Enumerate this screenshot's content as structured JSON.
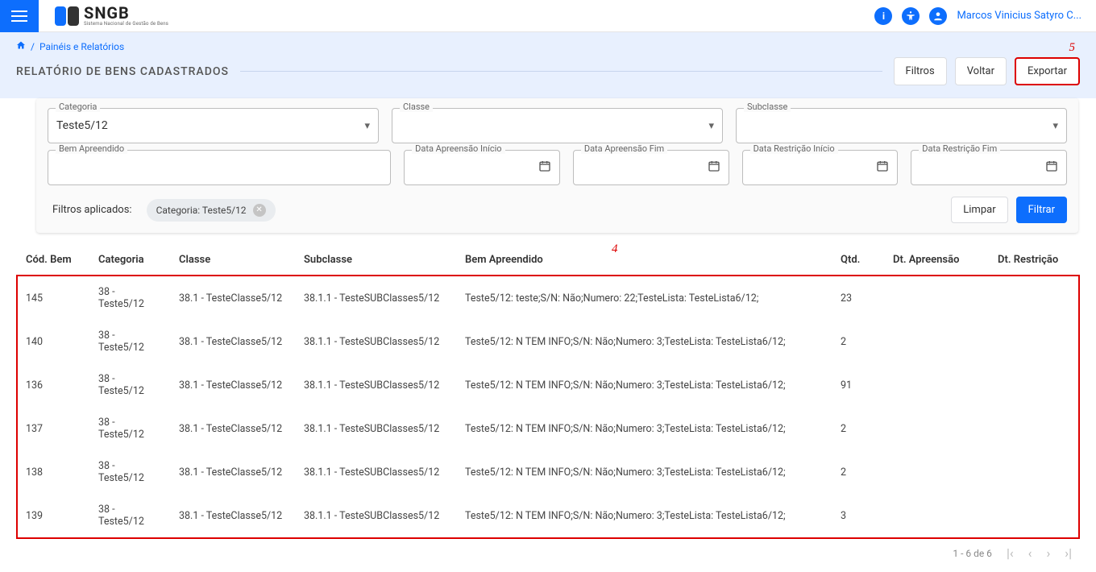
{
  "top": {
    "logo_text": "SNGB",
    "logo_sub": "Sistema Nacional de Gestão de Bens",
    "user": "Marcos Vinicius Satyro C..."
  },
  "breadcrumb": {
    "link": "Painéis e Relatórios"
  },
  "page": {
    "title": "RELATÓRIO DE BENS CADASTRADOS"
  },
  "buttons": {
    "filtros": "Filtros",
    "voltar": "Voltar",
    "exportar": "Exportar",
    "limpar": "Limpar",
    "filtrar": "Filtrar"
  },
  "annotations": {
    "exportar": "5",
    "table": "4"
  },
  "fields": {
    "categoria_label": "Categoria",
    "categoria_value": "Teste5/12",
    "classe_label": "Classe",
    "subclasse_label": "Subclasse",
    "bem_label": "Bem Apreendido",
    "data_ap_inicio": "Data Apreensão Início",
    "data_ap_fim": "Data Apreensão Fim",
    "data_re_inicio": "Data Restrição Início",
    "data_re_fim": "Data Restrição Fim"
  },
  "applied": {
    "label": "Filtros aplicados:",
    "chip": "Categoria: Teste5/12"
  },
  "table": {
    "headers": {
      "cod": "Cód. Bem",
      "cat": "Categoria",
      "cls": "Classe",
      "sub": "Subclasse",
      "bem": "Bem Apreendido",
      "qtd": "Qtd.",
      "dta": "Dt. Apreensão",
      "dtr": "Dt. Restrição"
    },
    "rows": [
      {
        "cod": "145",
        "cat": "38 - Teste5/12",
        "cls": "38.1 - TesteClasse5/12",
        "sub": "38.1.1 - TesteSUBClasses5/12",
        "bem": "Teste5/12: teste;S/N: Não;Numero: 22;TesteLista: TesteLista6/12;",
        "qtd": "23",
        "dta": "",
        "dtr": ""
      },
      {
        "cod": "140",
        "cat": "38 - Teste5/12",
        "cls": "38.1 - TesteClasse5/12",
        "sub": "38.1.1 - TesteSUBClasses5/12",
        "bem": "Teste5/12: N TEM INFO;S/N: Não;Numero: 3;TesteLista: TesteLista6/12;",
        "qtd": "2",
        "dta": "",
        "dtr": ""
      },
      {
        "cod": "136",
        "cat": "38 - Teste5/12",
        "cls": "38.1 - TesteClasse5/12",
        "sub": "38.1.1 - TesteSUBClasses5/12",
        "bem": "Teste5/12: N TEM INFO;S/N: Não;Numero: 3;TesteLista: TesteLista6/12;",
        "qtd": "91",
        "dta": "",
        "dtr": ""
      },
      {
        "cod": "137",
        "cat": "38 - Teste5/12",
        "cls": "38.1 - TesteClasse5/12",
        "sub": "38.1.1 - TesteSUBClasses5/12",
        "bem": "Teste5/12: N TEM INFO;S/N: Não;Numero: 3;TesteLista: TesteLista6/12;",
        "qtd": "2",
        "dta": "",
        "dtr": ""
      },
      {
        "cod": "138",
        "cat": "38 - Teste5/12",
        "cls": "38.1 - TesteClasse5/12",
        "sub": "38.1.1 - TesteSUBClasses5/12",
        "bem": "Teste5/12: N TEM INFO;S/N: Não;Numero: 3;TesteLista: TesteLista6/12;",
        "qtd": "2",
        "dta": "",
        "dtr": ""
      },
      {
        "cod": "139",
        "cat": "38 - Teste5/12",
        "cls": "38.1 - TesteClasse5/12",
        "sub": "38.1.1 - TesteSUBClasses5/12",
        "bem": "Teste5/12: N TEM INFO;S/N: Não;Numero: 3;TesteLista: TesteLista6/12;",
        "qtd": "3",
        "dta": "",
        "dtr": ""
      }
    ]
  },
  "paginator": {
    "range": "1 - 6 de 6"
  }
}
